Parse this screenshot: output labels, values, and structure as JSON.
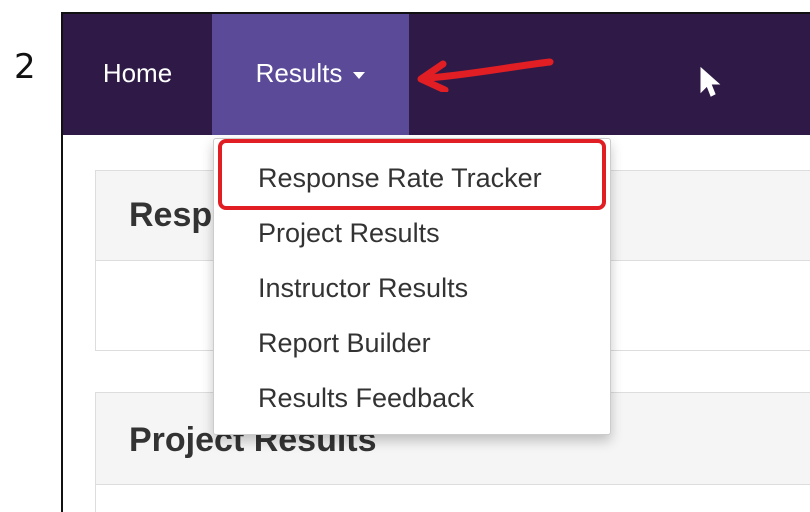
{
  "step": {
    "number": "2"
  },
  "nav": {
    "home_label": "Home",
    "results_label": "Results"
  },
  "dropdown": {
    "items": [
      {
        "label": "Response Rate Tracker"
      },
      {
        "label": "Project Results"
      },
      {
        "label": "Instructor Results"
      },
      {
        "label": "Report Builder"
      },
      {
        "label": "Results Feedback"
      }
    ]
  },
  "panels": [
    {
      "heading": "Response Rate Tracker"
    },
    {
      "heading": "Project Results"
    }
  ],
  "annotation": {
    "highlight_color": "#e01e24",
    "arrow_color": "#e01e24",
    "arrow_icon": "arrow-left-icon"
  },
  "colors": {
    "navbar": "#2f1a47",
    "nav_active": "#5b4a97"
  }
}
